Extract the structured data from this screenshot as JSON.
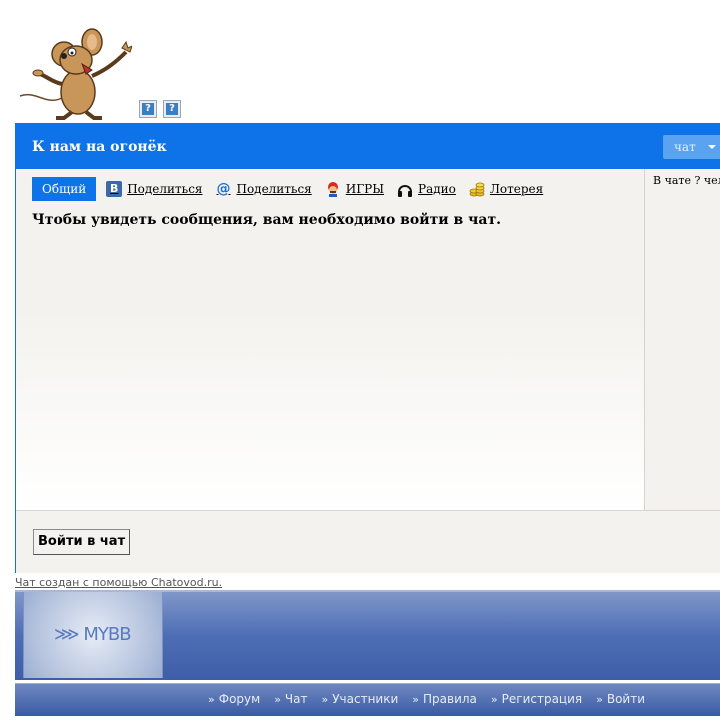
{
  "header_icons": [
    "help-icon",
    "help-icon"
  ],
  "help_glyph": "?",
  "chat": {
    "title": "К нам на огонёк",
    "dropdown_label": "чат",
    "active_tab": "Общий",
    "tabs": [
      {
        "label": "Поделиться",
        "icon": "vk-icon",
        "glyph": "В"
      },
      {
        "label": "Поделиться",
        "icon": "mail-at-icon",
        "glyph": "@"
      },
      {
        "label": "ИГРЫ",
        "icon": "mario-icon"
      },
      {
        "label": "Радио",
        "icon": "headphones-icon"
      },
      {
        "label": "Лотерея",
        "icon": "coins-icon"
      }
    ],
    "notice": "Чтобы увидеть сообщения, вам необходимо войти в чат.",
    "side_text": "В чате ? чел",
    "login_button": "Войти в чат"
  },
  "credit": "Чат создан с помощью Chatovod.ru.",
  "banner": {
    "logo": "MYBB",
    "logo_mark": "⋙ MYBB"
  },
  "nav": {
    "separator": "»",
    "links": [
      "Форум",
      "Чат",
      "Участники",
      "Правила",
      "Регистрация",
      "Войти"
    ]
  },
  "colors": {
    "accent": "#0e72e8",
    "banner": "#4d6db5"
  }
}
